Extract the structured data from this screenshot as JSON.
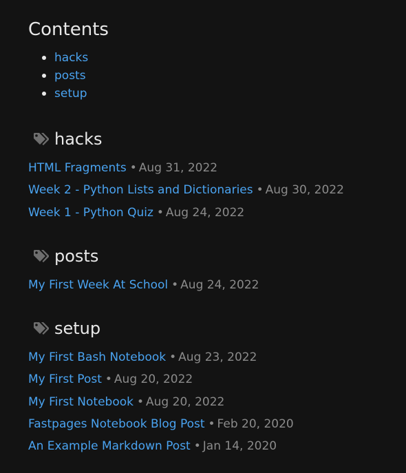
{
  "contents": {
    "title": "Contents",
    "items": [
      {
        "label": "hacks"
      },
      {
        "label": "posts"
      },
      {
        "label": "setup"
      }
    ]
  },
  "sections": [
    {
      "tag": "hacks",
      "posts": [
        {
          "title": "HTML Fragments",
          "date": "Aug 31, 2022"
        },
        {
          "title": "Week 2 - Python Lists and Dictionaries",
          "date": "Aug 30, 2022"
        },
        {
          "title": "Week 1 - Python Quiz",
          "date": "Aug 24, 2022"
        }
      ]
    },
    {
      "tag": "posts",
      "posts": [
        {
          "title": "My First Week At School",
          "date": "Aug 24, 2022"
        }
      ]
    },
    {
      "tag": "setup",
      "posts": [
        {
          "title": "My First Bash Notebook",
          "date": "Aug 23, 2022"
        },
        {
          "title": "My First Post",
          "date": "Aug 20, 2022"
        },
        {
          "title": "My First Notebook",
          "date": "Aug 20, 2022"
        },
        {
          "title": "Fastpages Notebook Blog Post",
          "date": "Feb 20, 2020"
        },
        {
          "title": "An Example Markdown Post",
          "date": "Jan 14, 2020"
        }
      ]
    }
  ],
  "separator": "•",
  "colors": {
    "background": "#131313",
    "link": "#4aa3f0",
    "text": "#e8e8e8",
    "muted": "#8b8b8b",
    "tag_icon": "#6e6e6e"
  },
  "icons": {
    "section_heading": "tags-icon"
  }
}
